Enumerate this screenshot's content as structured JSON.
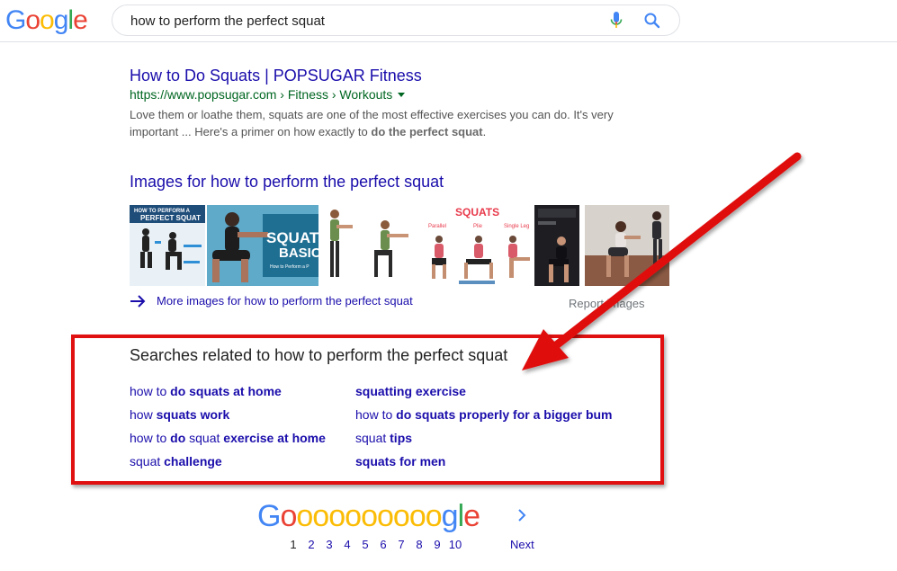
{
  "header": {
    "logo_letters": [
      "G",
      "o",
      "o",
      "g",
      "l",
      "e"
    ],
    "logo_colors": [
      "#4285F4",
      "#EA4335",
      "#FBBC05",
      "#4285F4",
      "#34A853",
      "#EA4335"
    ],
    "search_value": "how to perform the perfect squat"
  },
  "result": {
    "title": "How to Do Squats | POPSUGAR Fitness",
    "url": "https://www.popsugar.com › Fitness › Workouts",
    "snippet_pre": "Love them or loathe them, squats are one of the most effective exercises you can do. It's very important ... Here's a primer on how exactly to ",
    "snippet_bold": "do the perfect squat",
    "snippet_post": "."
  },
  "images": {
    "heading": "Images for how to perform the perfect squat",
    "thumb1_line1": "HOW TO PERFORM A",
    "thumb1_line2": "PERFECT SQUAT",
    "thumb2_line1": "SQUATS",
    "thumb2_line2": "BASIC",
    "thumb2_line3": "How to Perform a P",
    "thumb4_title": "SQUATS",
    "thumb4_labels": [
      "Parallel",
      "Plie",
      "Single Leg"
    ],
    "more_label": "More images for how to perform the perfect squat",
    "report_label": "Report images"
  },
  "related": {
    "heading": "Searches related to how to perform the perfect squat",
    "left": [
      {
        "pre": "how to ",
        "bold": "do squats at home"
      },
      {
        "pre": "how ",
        "bold": "squats work"
      },
      {
        "pre": "how to ",
        "bold": "do",
        "mid": " squat ",
        "bold2": "exercise at home"
      },
      {
        "pre": "squat ",
        "bold": "challenge"
      }
    ],
    "right": [
      {
        "pre": "",
        "bold": "squatting exercise"
      },
      {
        "pre": "how to ",
        "bold": "do squats properly for a bigger bum"
      },
      {
        "pre": "squat ",
        "bold": "tips"
      },
      {
        "pre": "",
        "bold": "squats for men"
      }
    ]
  },
  "pagination": {
    "logo_text": "Goooooooooogle",
    "pages": [
      "1",
      "2",
      "3",
      "4",
      "5",
      "6",
      "7",
      "8",
      "9",
      "10"
    ],
    "current_page": "1",
    "next_label": "Next"
  },
  "annotation": {
    "box_color": "#e01010",
    "arrow_color": "#e01010"
  }
}
